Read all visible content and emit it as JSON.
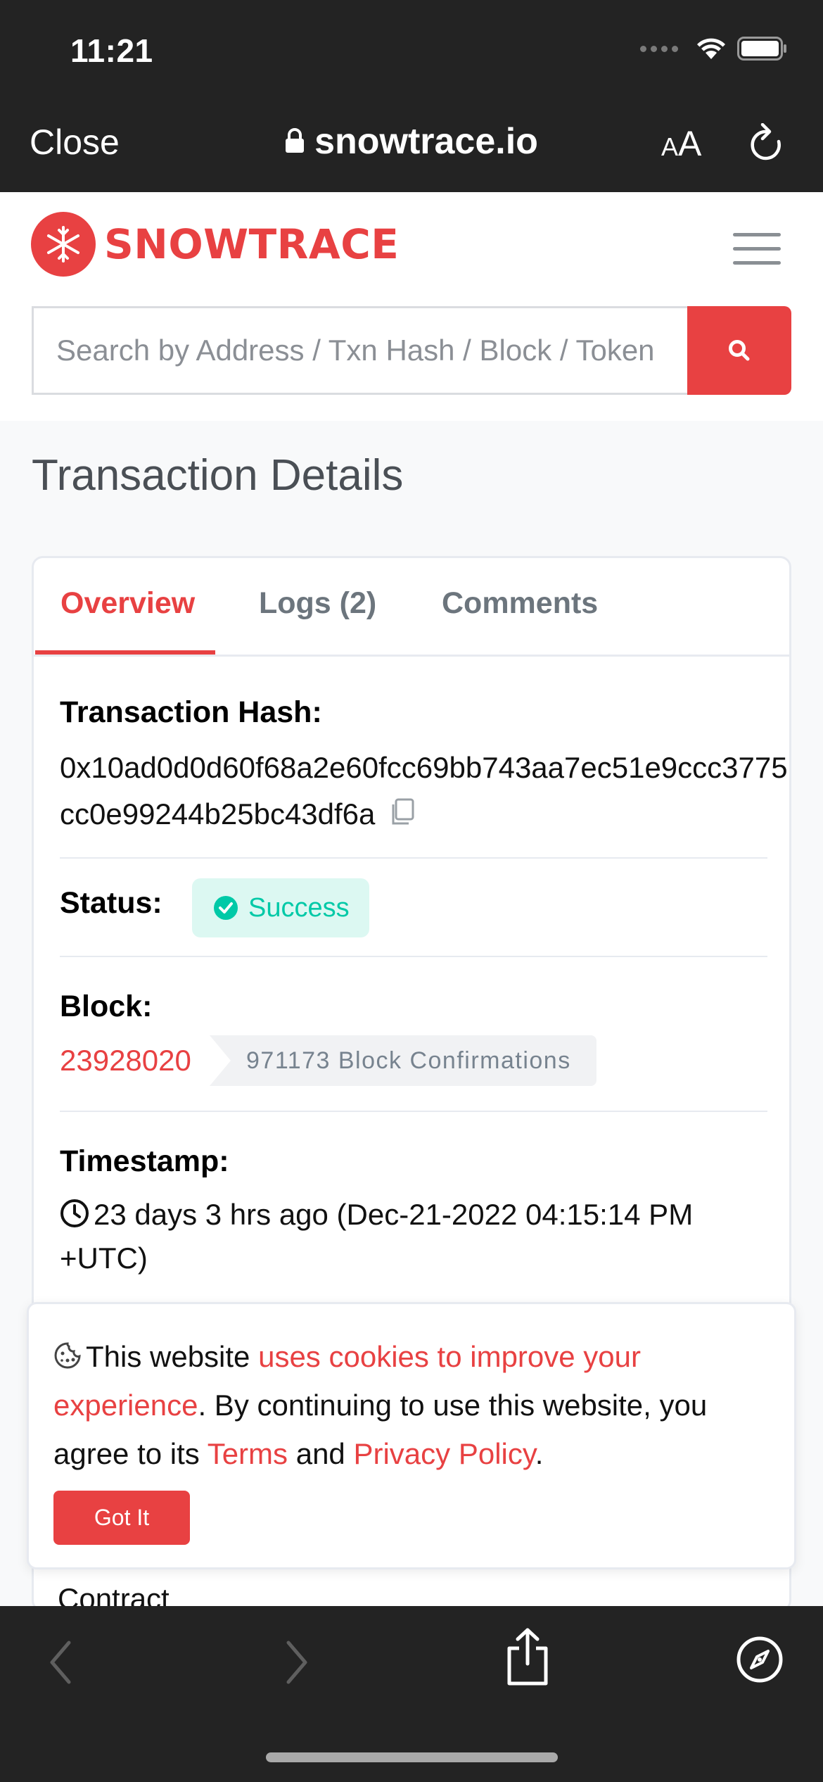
{
  "status_bar": {
    "time": "11:21"
  },
  "browser": {
    "close_label": "Close",
    "url": "snowtrace.io",
    "text_size_label_small": "A",
    "text_size_label_large": "A"
  },
  "site": {
    "brand": "SNOWTRACE",
    "brand_color": "#e84142",
    "search_placeholder": "Search by Address / Txn Hash / Block / Token"
  },
  "page": {
    "title": "Transaction Details"
  },
  "tabs": [
    {
      "label": "Overview",
      "active": true
    },
    {
      "label": "Logs (2)",
      "active": false
    },
    {
      "label": "Comments",
      "active": false
    }
  ],
  "details": {
    "hash_label": "Transaction Hash:",
    "hash_value": "0x10ad0d0d60f68a2e60fcc69bb743aa7ec51e9ccc3775cc0e99244b25bc43df6a",
    "status_label": "Status:",
    "status_value": "Success",
    "status_color": "#00c9a7",
    "block_label": "Block:",
    "block_value": "23928020",
    "block_confirmations": "971173 Block Confirmations",
    "timestamp_label": "Timestamp:",
    "timestamp_value": "23 days 3 hrs ago (Dec-21-2022 04:15:14 PM +UTC)",
    "next_label_partial": "Contract"
  },
  "cookie_banner": {
    "text_1": "This website ",
    "link_1": "uses cookies to improve your experience",
    "text_2": ". By continuing to use this website, you agree to its ",
    "link_terms": "Terms",
    "text_3": " and ",
    "link_privacy": "Privacy Policy",
    "text_4": ".",
    "button_label": "Got It"
  }
}
